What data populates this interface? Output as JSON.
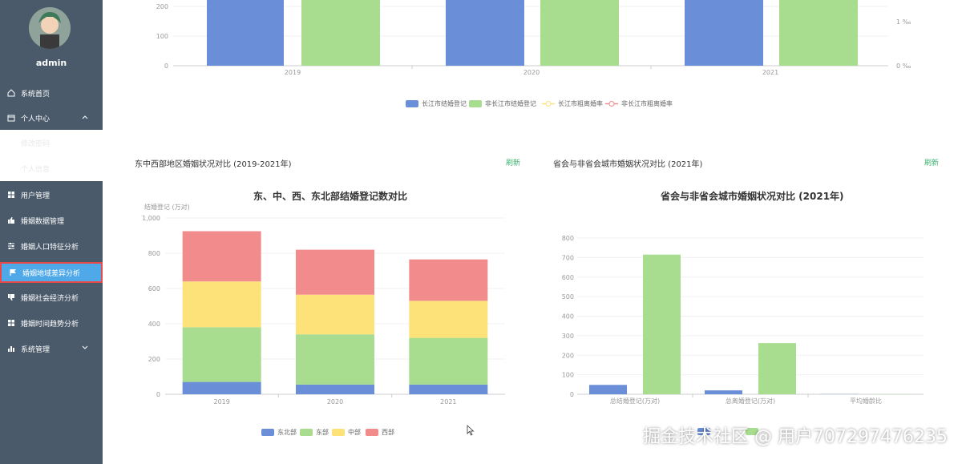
{
  "sidebar": {
    "username": "admin",
    "items": [
      {
        "label": "系统首页",
        "icon": "home-icon"
      },
      {
        "label": "个人中心",
        "icon": "calendar-icon"
      },
      {
        "label": "修改密码",
        "icon": ""
      },
      {
        "label": "个人信息",
        "icon": ""
      },
      {
        "label": "用户管理",
        "icon": "grid-icon"
      },
      {
        "label": "婚姻数据管理",
        "icon": "thumbs-up-icon"
      },
      {
        "label": "婚姻人口特征分析",
        "icon": "sliders-icon"
      },
      {
        "label": "婚姻地域差异分析",
        "icon": "flag-icon"
      },
      {
        "label": "婚姻社会经济分析",
        "icon": "thumbs-down-icon"
      },
      {
        "label": "婚姻时间趋势分析",
        "icon": "grid-icon"
      },
      {
        "label": "系统管理",
        "icon": "bar-chart-icon"
      }
    ]
  },
  "top_chart": {
    "y_ticks": [
      "200",
      "100",
      "0"
    ],
    "right_ticks": [
      "1 ‰",
      "0 ‰"
    ],
    "years": [
      "2019",
      "2020",
      "2021"
    ],
    "legend": [
      "长江市结婚登记",
      "非长江市结婚登记",
      "长江市粗离婚率",
      "非长江市粗离婚率"
    ],
    "colors": [
      "#6a8fd8",
      "#a8dc8e",
      "#fde27a",
      "#f28c8c"
    ]
  },
  "section_left": {
    "title": "东中西部地区婚姻状况对比 (2019-2021年)",
    "refresh": "刷新",
    "chart_title": "东、中、西、东北部结婚登记数对比",
    "ylabel": "结婚登记 (万对)",
    "y_ticks": [
      "1,000",
      "800",
      "600",
      "400",
      "200",
      "0"
    ],
    "x_ticks": [
      "2019",
      "2020",
      "2021"
    ],
    "legend": [
      "东北部",
      "东部",
      "中部",
      "西部"
    ]
  },
  "section_right": {
    "title": "省会与非省会城市婚姻状况对比 (2021年)",
    "refresh": "刷新",
    "chart_title": "省会与非省会城市婚姻状况对比 (2021年)",
    "y_ticks": [
      "800",
      "700",
      "600",
      "500",
      "400",
      "300",
      "200",
      "100",
      "0"
    ],
    "x_ticks": [
      "总结婚登记(万对)",
      "总离婚登记(万对)",
      "平均婚龄比"
    ]
  },
  "watermark": "掘金技术社区 @ 用户707297476235",
  "chart_data": [
    {
      "type": "bar",
      "categories": [
        "2019",
        "2020",
        "2021"
      ],
      "series": [
        {
          "name": "东北部",
          "values": [
            70,
            55,
            55
          ]
        },
        {
          "name": "东部",
          "values": [
            310,
            285,
            265
          ]
        },
        {
          "name": "中部",
          "values": [
            260,
            225,
            210
          ]
        },
        {
          "name": "西部",
          "values": [
            285,
            255,
            235
          ]
        }
      ],
      "stacked": true,
      "title": "东、中、西、东北部结婚登记数对比",
      "ylabel": "结婚登记 (万对)",
      "ylim": [
        0,
        1000
      ]
    },
    {
      "type": "bar",
      "categories": [
        "总结婚登记(万对)",
        "总离婚登记(万对)",
        "平均婚龄比"
      ],
      "series": [
        {
          "values": [
            48,
            20,
            1
          ]
        },
        {
          "values": [
            715,
            262,
            1
          ]
        }
      ],
      "title": "省会与非省会城市婚姻状况对比 (2021年)",
      "ylim": [
        0,
        800
      ]
    }
  ]
}
